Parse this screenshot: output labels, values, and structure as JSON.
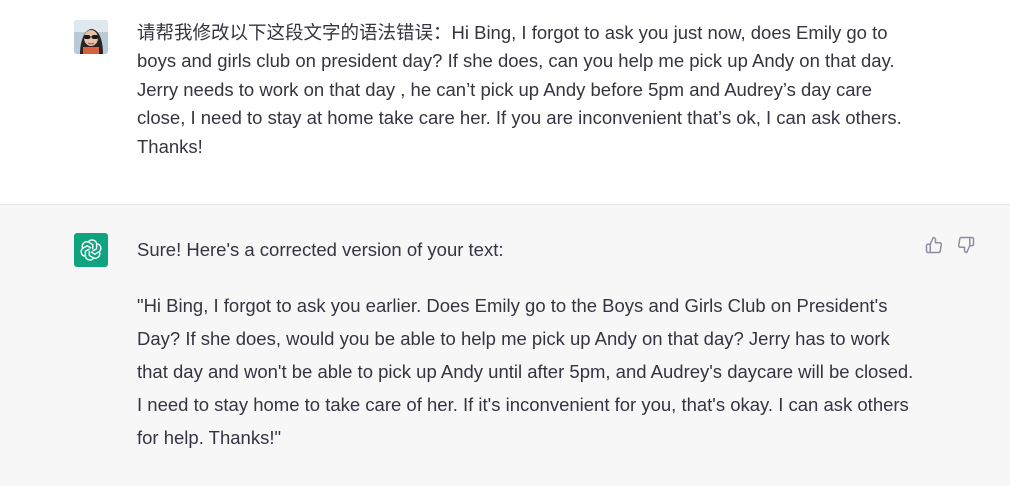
{
  "conversation": {
    "user_message": "请帮我修改以下这段文字的语法错误：Hi Bing, I forgot to ask you just now, does Emily go to boys and girls club on president day? If she does, can you help me pick up Andy on that day. Jerry needs to work on that day , he can’t pick up Andy before 5pm and Audrey’s day care close, I need to stay at home take care her. If you are inconvenient that’s ok, I can ask others. Thanks!",
    "assistant_intro": "Sure! Here's a corrected version of your text:",
    "assistant_corrected": "\"Hi Bing, I forgot to ask you earlier. Does Emily go to the Boys and Girls Club on President's Day? If she does, would you be able to help me pick up Andy on that day? Jerry has to work that day and won't be able to pick up Andy until after 5pm, and Audrey's daycare will be closed. I need to stay home to take care of her. If it's inconvenient for you, that's okay. I can ask others for help. Thanks!\""
  },
  "icons": {
    "user_avatar": "user-avatar",
    "assistant_avatar": "openai-logo-icon",
    "thumbs_up": "thumbs-up-icon",
    "thumbs_down": "thumbs-down-icon"
  },
  "colors": {
    "assistant_bg": "#f7f7f8",
    "brand_green": "#10a37f",
    "text": "#343541"
  }
}
